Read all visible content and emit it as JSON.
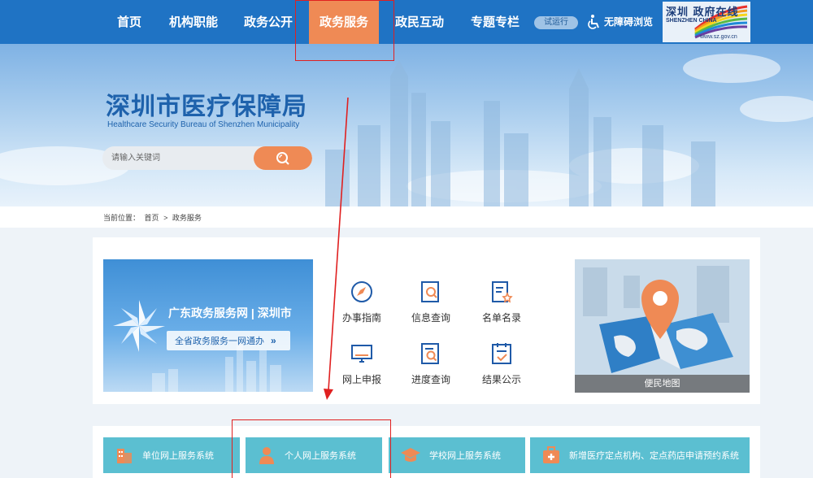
{
  "nav": {
    "items": [
      {
        "label": "首页"
      },
      {
        "label": "机构职能"
      },
      {
        "label": "政务公开"
      },
      {
        "label": "政务服务"
      },
      {
        "label": "政民互动"
      },
      {
        "label": "专题专栏"
      }
    ],
    "trial_badge": "试运行",
    "accessibility": "无障碍浏览",
    "logo": {
      "cn": "深圳 政府在线",
      "en": "SHENZHEN  CHINA",
      "url": "www.sz.gov.cn"
    }
  },
  "hero": {
    "title": "深圳市医疗保障局",
    "subtitle": "Healthcare Security Bureau of Shenzhen Municipality",
    "search_placeholder": "请输入关键词"
  },
  "breadcrumb": {
    "prefix": "当前位置：",
    "home": "首页",
    "separator": ">",
    "current": "政务服务"
  },
  "banner": {
    "title": "广东政务服务网 | 深圳市",
    "pill": "全省政务服务一网通办",
    "pill_arrow": "»"
  },
  "services": [
    {
      "label": "办事指南",
      "icon": "compass-icon"
    },
    {
      "label": "信息查询",
      "icon": "document-search-icon"
    },
    {
      "label": "名单名录",
      "icon": "list-star-icon"
    },
    {
      "label": "网上申报",
      "icon": "monitor-icon"
    },
    {
      "label": "进度查询",
      "icon": "progress-search-icon"
    },
    {
      "label": "结果公示",
      "icon": "result-check-icon"
    }
  ],
  "map_card": {
    "caption": "便民地图"
  },
  "systems": [
    {
      "label": "单位网上服务系统",
      "icon": "building-icon"
    },
    {
      "label": "个人网上服务系统",
      "icon": "person-icon"
    },
    {
      "label": "学校网上服务系统",
      "icon": "graduation-cap-icon"
    },
    {
      "label": "新增医疗定点机构、定点药店申请预约系统",
      "icon": "medical-kit-icon"
    }
  ],
  "colors": {
    "nav_bg": "#1f73c4",
    "accent_orange": "#ef8a55",
    "title_blue": "#1e62ac",
    "system_tile": "#5bc0d2",
    "annotation_red": "#e02020"
  }
}
